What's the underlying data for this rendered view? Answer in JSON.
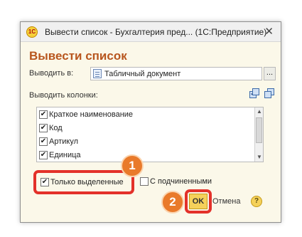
{
  "window": {
    "app_logo": "1С",
    "title": "Вывести список - Бухгалтерия пред... (1С:Предприятие)",
    "close": "✕"
  },
  "form": {
    "title": "Вывести список",
    "output_label": "Выводить в:",
    "output_value": "Табличный документ",
    "ellipsis": "...",
    "columns_label": "Выводить колонки:"
  },
  "columns_list": [
    {
      "label": "Краткое наименование",
      "checked": true
    },
    {
      "label": "Код",
      "checked": true
    },
    {
      "label": "Артикул",
      "checked": true
    },
    {
      "label": "Единица",
      "checked": true
    }
  ],
  "options": {
    "only_selected_label": "Только выделенные",
    "only_selected_checked": true,
    "with_subordinates_label": "С подчиненными",
    "with_subordinates_checked": false
  },
  "buttons": {
    "ok": "OK",
    "cancel": "Отмена",
    "help": "?"
  },
  "annotations": {
    "badge1": "1",
    "badge2": "2"
  },
  "colors": {
    "accent_title": "#b8561e",
    "highlight": "#e3312a",
    "badge": "#e97a2a",
    "ok_button": "#f5d15a"
  }
}
